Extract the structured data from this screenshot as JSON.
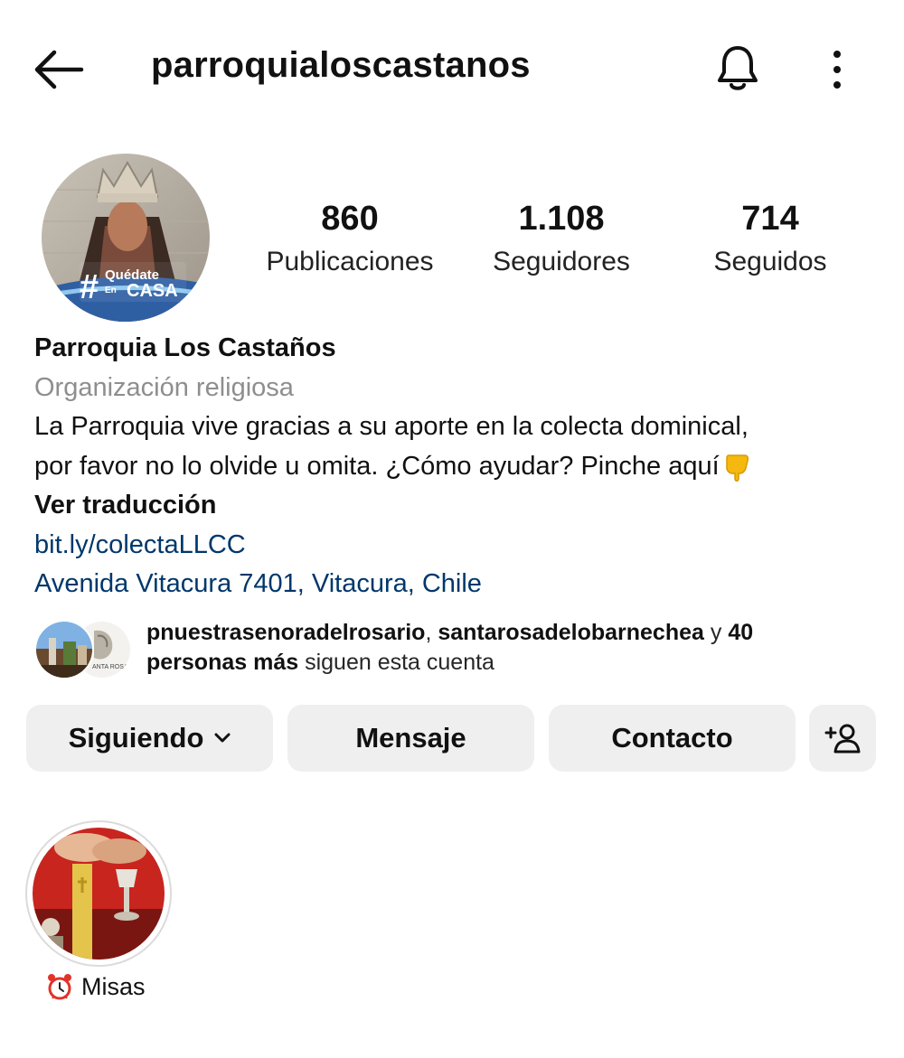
{
  "header": {
    "back_icon": "arrow-left-icon",
    "username": "parroquialoscastanos",
    "bell_icon": "bell-icon",
    "more_icon": "more-vertical-icon"
  },
  "avatar": {
    "badge_hash": "#",
    "badge_line1": "Quédate",
    "badge_line2": "CASA",
    "badge_small": "En"
  },
  "stats": [
    {
      "value": "860",
      "label": "Publicaciones"
    },
    {
      "value": "1.108",
      "label": "Seguidores"
    },
    {
      "value": "714",
      "label": "Seguidos"
    }
  ],
  "bio": {
    "name": "Parroquia Los Castaños",
    "category": "Organización religiosa",
    "line1": "La Parroquia vive gracias a su aporte en la colecta dominical,",
    "line2": "por favor no lo olvide u omita. ¿Cómo ayudar? Pinche aquí",
    "translate": "Ver traducción",
    "link": "bit.ly/colectaLLCC",
    "address": "Avenida Vitacura 7401, Vitacura, Chile"
  },
  "followed_by": {
    "user1": "pnuestrasenoradelrosario",
    "sep": ", ",
    "user2": "santarosadelobarnechea",
    "and": " y ",
    "count": "40",
    "more": "personas más",
    "suffix": " siguen esta cuenta",
    "avatar2_text": "ANTA ROSA"
  },
  "buttons": {
    "following": "Siguiendo",
    "message": "Mensaje",
    "contact": "Contacto",
    "add_user_icon": "add-user-icon"
  },
  "highlights": [
    {
      "label": "Misas",
      "icon": "alarm-clock-icon"
    }
  ],
  "colors": {
    "link": "#00376b",
    "button_bg": "#efefef",
    "secondary_text": "#8e8e8e"
  }
}
